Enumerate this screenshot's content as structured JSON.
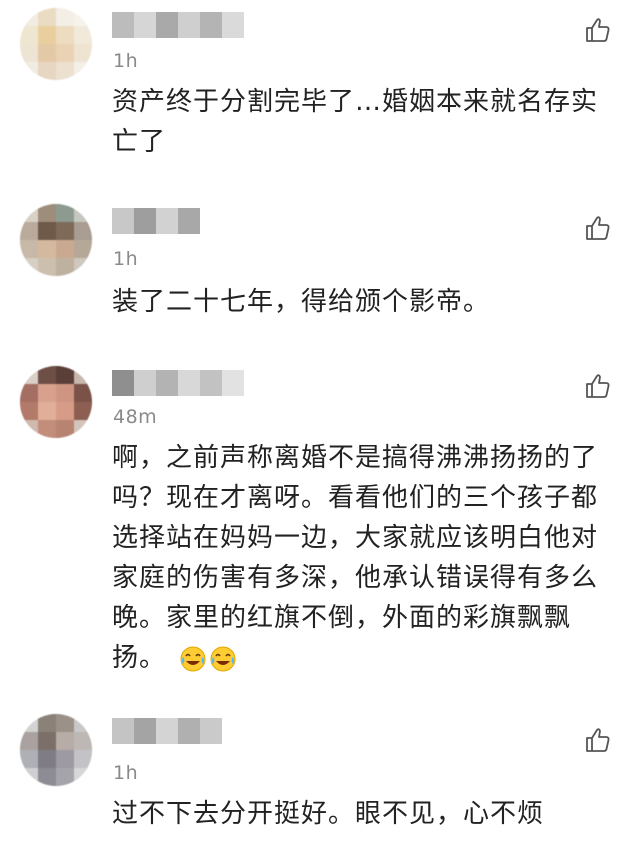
{
  "comments": [
    {
      "time": "1h",
      "text": "资产终于分割完毕了…婚姻本来就名存实亡了"
    },
    {
      "time": "1h",
      "text": "装了二十七年，得给颁个影帝。"
    },
    {
      "time": "48m",
      "text": "啊，之前声称离婚不是搞得沸沸扬扬的了吗？现在才离呀。看看他们的三个孩子都选择站在妈妈一边，大家就应该明白他对家庭的伤害有多深，他承认错误得有多么晚。家里的红旗不倒，外面的彩旗飘飘扬。",
      "emoji": [
        "crying-laughing-emoji",
        "crying-laughing-emoji"
      ]
    },
    {
      "time": "1h",
      "text": "过不下去分开挺好。眼不见，心不烦"
    }
  ],
  "icons": {
    "like": "thumbs-up-icon"
  },
  "colors": {
    "time": "#8a8a8a",
    "text": "#222222",
    "icon": "#555555"
  }
}
